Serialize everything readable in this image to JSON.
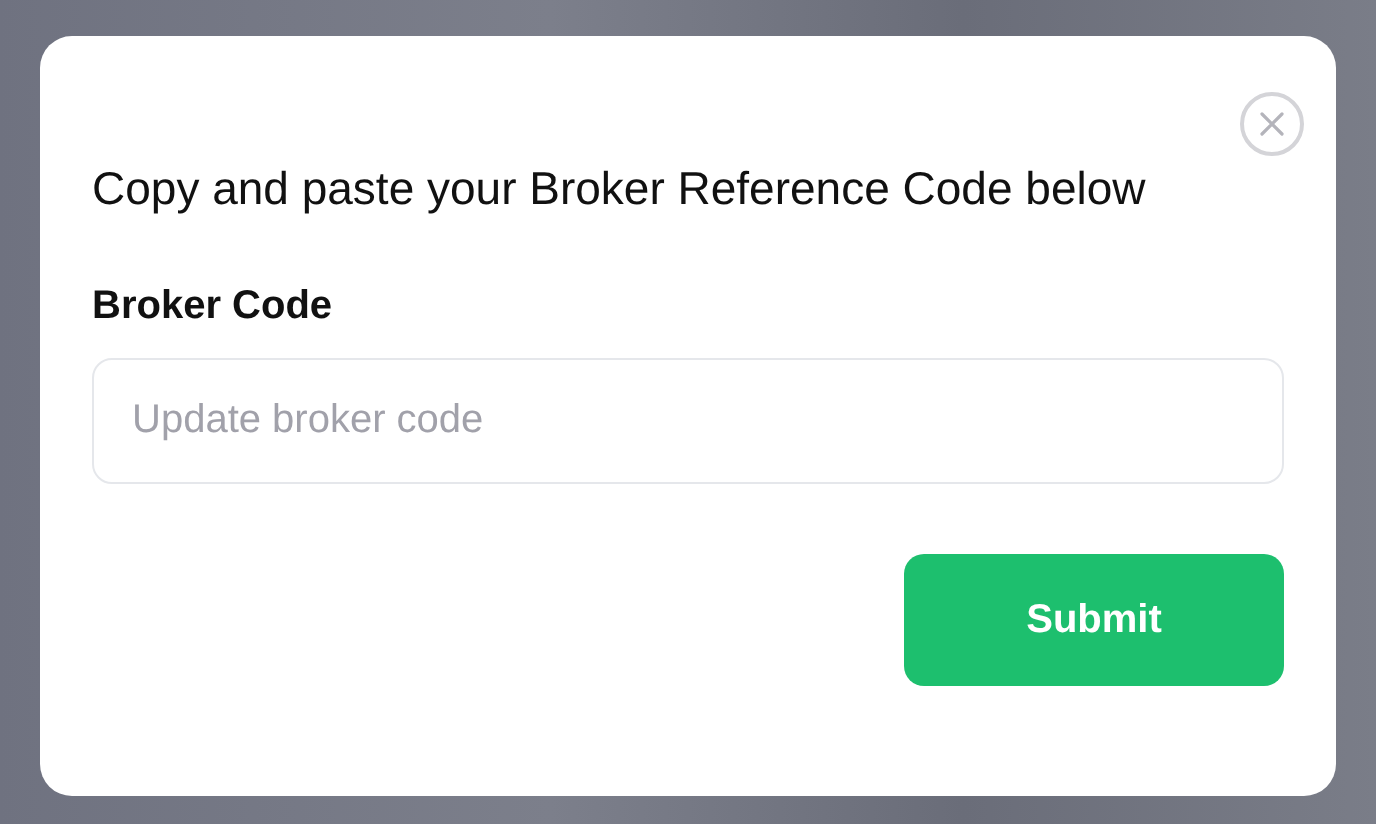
{
  "dialog": {
    "title": "Copy and paste your Broker Reference Code below",
    "field": {
      "label": "Broker Code",
      "placeholder": "Update broker code"
    },
    "submit_button": "Submit"
  }
}
